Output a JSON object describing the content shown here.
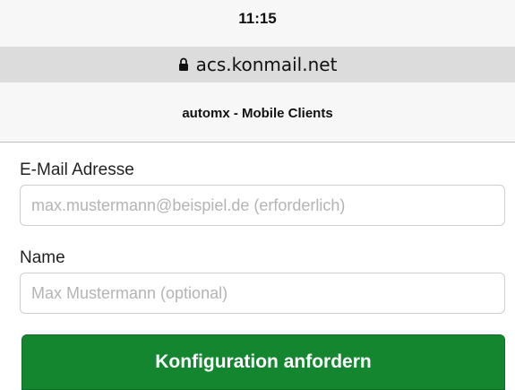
{
  "status_bar": {
    "time": "11:15"
  },
  "browser": {
    "url": "acs.konmail.net",
    "lock_icon": "lock-icon"
  },
  "page": {
    "title": "automx - Mobile Clients"
  },
  "form": {
    "email": {
      "label": "E-Mail Adresse",
      "value": "",
      "placeholder": "max.mustermann@beispiel.de (erforderlich)"
    },
    "name": {
      "label": "Name",
      "value": "",
      "placeholder": "Max Mustermann (optional)"
    },
    "submit_label": "Konfiguration anfordern"
  },
  "colors": {
    "button_bg": "#13862f",
    "url_bar_bg": "#dcdcdc",
    "header_bg": "#f7f7f7"
  }
}
